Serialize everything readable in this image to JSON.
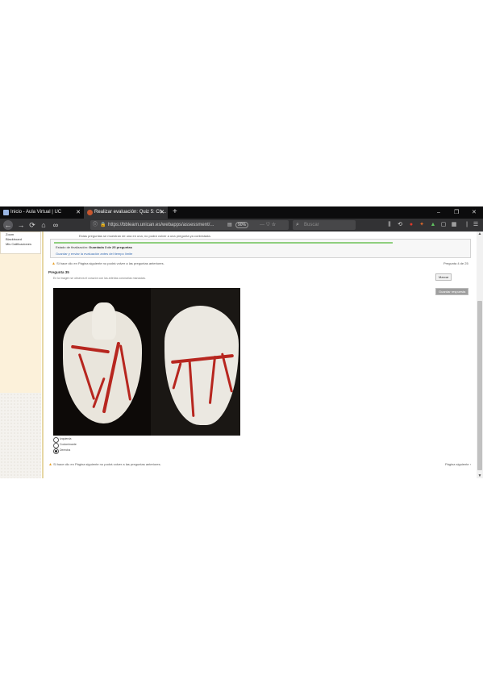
{
  "browser": {
    "tabs": [
      {
        "title": "Inicio - Aula Virtual | UC",
        "active": false
      },
      {
        "title": "Realizar evaluación: Quiz 5: Ch...",
        "active": true
      }
    ],
    "url": "https://bblearn.unican.es/webapps/assessment/...",
    "zoom": "90%",
    "search_placeholder": "Buscar",
    "url_icons": "···  ♡  ☆"
  },
  "sidebar": {
    "items": [
      "Zoom",
      "Blackboard",
      "Mis Calificaciones"
    ]
  },
  "page": {
    "top_note": "Estas preguntas se muestran de una en una; no podrá volver a una pregunta ya contestada.",
    "submission": {
      "status_prefix": "Estado de finalización:",
      "status_value": "Guardada 3 de 25 preguntas",
      "link": "Guardar y enviar la evaluación antes del tiempo límite"
    },
    "warning_top": "Si hace clic en Página siguiente no podrá volver a las preguntas anteriores.",
    "score_top": "Pregunta 4 de 25",
    "question_title": "Pregunta 35",
    "question_subtitle": "En la imagen se observa el corazón con las arterias coronarias marcadas.",
    "mark_buttons": [
      "Marcar",
      "Guardar respuesta"
    ],
    "options": [
      {
        "label": "Izquierda",
        "selected": false
      },
      {
        "label": "Codominante",
        "selected": false
      },
      {
        "label": "Derecha",
        "selected": true
      }
    ],
    "warning_bottom": "Si hace clic en Página siguiente no podrá volver a las preguntas anteriores.",
    "score_bottom": "Página siguiente ›"
  }
}
